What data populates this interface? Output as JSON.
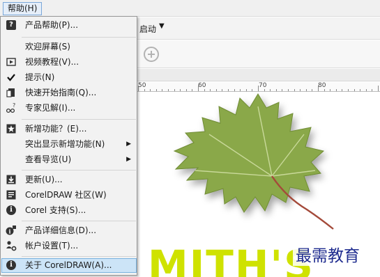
{
  "menubar": {
    "help_label": "帮助(H)"
  },
  "toolbar": {
    "partial_label": "启动",
    "caret": "▼"
  },
  "ruler": {
    "labels": [
      "50",
      "60",
      "70",
      "80"
    ]
  },
  "canvas": {
    "big_text": "MITH'S",
    "watermark": "最需教育"
  },
  "help_menu": {
    "items": [
      {
        "label": "产品帮助(P)...",
        "icon": "help-book-icon"
      },
      {
        "label": "欢迎屏幕(S)",
        "icon": "none"
      },
      {
        "label": "视频教程(V)...",
        "icon": "video-icon"
      },
      {
        "label": "提示(N)",
        "icon": "checkmark-icon",
        "checked": true
      },
      {
        "label": "快速开始指南(Q)...",
        "icon": "quickstart-icon"
      },
      {
        "label": "专家见解(I)...",
        "icon": "expert-insights-icon"
      },
      {
        "label": "新增功能？(E)...",
        "icon": "new-features-icon"
      },
      {
        "label": "突出显示新增功能(N)",
        "icon": "none",
        "submenu": true
      },
      {
        "label": "查看导览(U)",
        "icon": "none",
        "submenu": true
      },
      {
        "label": "更新(U)...",
        "icon": "download-icon"
      },
      {
        "label": "CorelDRAW 社区(W)",
        "icon": "community-icon"
      },
      {
        "label": "Corel 支持(S)...",
        "icon": "info-icon"
      },
      {
        "label": "产品详细信息(D)...",
        "icon": "product-details-icon"
      },
      {
        "label": "帐户设置(T)...",
        "icon": "account-settings-icon"
      },
      {
        "label": "关于 CorelDRAW(A)...",
        "icon": "info-icon",
        "highlighted": true
      }
    ]
  },
  "colors": {
    "menu_bg": "#f2f2f2",
    "highlight": "#cce4f7",
    "leaf": "#8aa84a",
    "accent_text": "#cfe200",
    "watermark": "#1f2c8f"
  }
}
